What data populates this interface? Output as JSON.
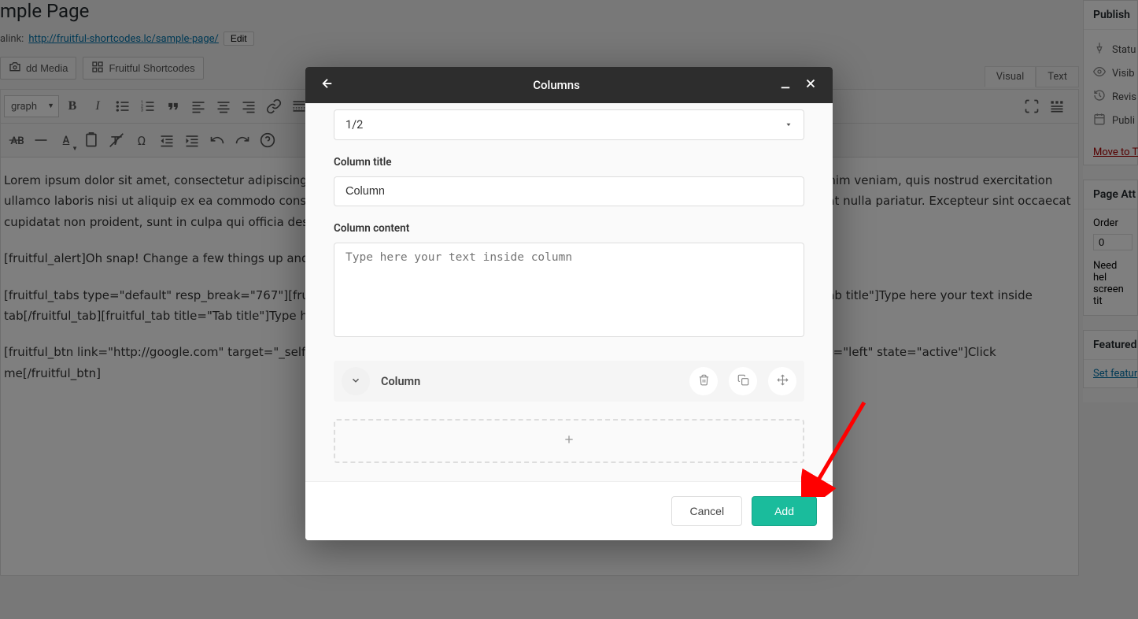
{
  "page": {
    "title": "mple Page",
    "permalink_label": "alink:",
    "permalink_url": "http://fruitful-shortcodes.lc/sample-page/",
    "edit_btn": "Edit"
  },
  "toolbar": {
    "add_media": "dd Media",
    "shortcodes": "Fruitful Shortcodes"
  },
  "editor_tabs": {
    "visual": "Visual",
    "text": "Text"
  },
  "tinymce": {
    "format_select": "graph"
  },
  "content": {
    "p1": "Lorem ipsum dolor sit amet, consectetur adipiscing elit, sed do eiusmod tempor incididunt ut labore et dolore magna aliqua. Ut enim ad minim veniam, quis nostrud exercitation ullamco laboris nisi ut aliquip ex ea commodo consequat. Duis aute irure dolor in reprehenderit in voluptate velit esse cillum dolore eu fugiat nulla pariatur. Excepteur sint occaecat cupidatat non proident, sunt in culpa qui officia deserunt mollit anim id est laborum.",
    "p2": "[fruitful_alert]Oh snap! Change a few things up and try submitting again.[/fruitful_alert]",
    "p3": "[fruitful_tabs type=\"default\" resp_break=\"767\"][fruitful_tab title=\"Tab title\"]Type here your text inside tab[/fruitful_tab][fruitful_tab title=\"Tab title\"]Type here your text inside tab[/fruitful_tab][fruitful_tab title=\"Tab title\"]Type here your text inside tab[/fruitful_tab][/fruitful_tabs]",
    "p4": "[fruitful_btn link=\"http://google.com\" target=\"_self\" icon=\"\" class=\"fruitful-btn-5be1b6f32e98f\" size=\"mini\" color=\"default\" radius=\"\" align=\"left\" state=\"active\"]Click me[/fruitful_btn]"
  },
  "sidebar": {
    "publish_box": "Publish",
    "status": "Statu",
    "visibility": "Visib",
    "revisions": "Revis",
    "publish": "Publi",
    "move_trash": "Move to T",
    "page_attr_box": "Page Att",
    "order_label": "Order",
    "order_value": "0",
    "help_text": "Need hel\nscreen tit",
    "featured_box": "Featured",
    "set_featured": "Set featur"
  },
  "modal": {
    "title": "Columns",
    "size_value": "1/2",
    "column_title_label": "Column title",
    "column_title_value": "Column",
    "column_content_label": "Column content",
    "column_content_placeholder": "Type here your text inside column",
    "collapse_label": "Column",
    "cancel_btn": "Cancel",
    "add_btn": "Add"
  }
}
